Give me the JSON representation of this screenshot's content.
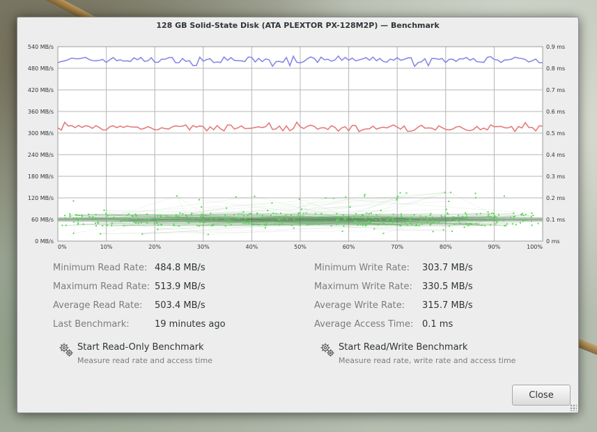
{
  "window": {
    "title": "128 GB Solid-State Disk (ATA PLEXTOR PX-128M2P) — Benchmark"
  },
  "graph": {
    "left_axis": [
      "0 MB/s",
      "60 MB/s",
      "120 MB/s",
      "180 MB/s",
      "240 MB/s",
      "300 MB/s",
      "360 MB/s",
      "420 MB/s",
      "480 MB/s",
      "540 MB/s"
    ],
    "right_axis": [
      "0 ms",
      "0.1 ms",
      "0.2 ms",
      "0.3 ms",
      "0.4 ms",
      "0.5 ms",
      "0.6 ms",
      "0.7 ms",
      "0.8 ms",
      "0.9 ms"
    ],
    "x_axis": [
      "0%",
      "10%",
      "20%",
      "30%",
      "40%",
      "50%",
      "60%",
      "70%",
      "80%",
      "90%",
      "100%"
    ],
    "colors": {
      "read": "#8a87e8",
      "write": "#e47a7a",
      "access": "#56d656",
      "grid": "#b4b4b4"
    }
  },
  "stats": {
    "left": [
      {
        "label": "Minimum Read Rate:",
        "value": "484.8 MB/s"
      },
      {
        "label": "Maximum Read Rate:",
        "value": "513.9 MB/s"
      },
      {
        "label": "Average Read Rate:",
        "value": "503.4 MB/s"
      },
      {
        "label": "Last Benchmark:",
        "value": "19 minutes ago"
      }
    ],
    "right": [
      {
        "label": "Minimum Write Rate:",
        "value": "303.7 MB/s"
      },
      {
        "label": "Maximum Write Rate:",
        "value": "330.5 MB/s"
      },
      {
        "label": "Average Write Rate:",
        "value": "315.7 MB/s"
      },
      {
        "label": "Average Access Time:",
        "value": "0.1 ms"
      }
    ]
  },
  "benchmarks": {
    "read_only": {
      "label": "Start Read-Only Benchmark",
      "description": "Measure read rate and access time",
      "icon": "gears-icon"
    },
    "read_write": {
      "label": "Start Read/Write Benchmark",
      "description": "Measure read rate, write rate and access time",
      "icon": "gears-icon"
    }
  },
  "buttons": {
    "close": "Close"
  }
}
